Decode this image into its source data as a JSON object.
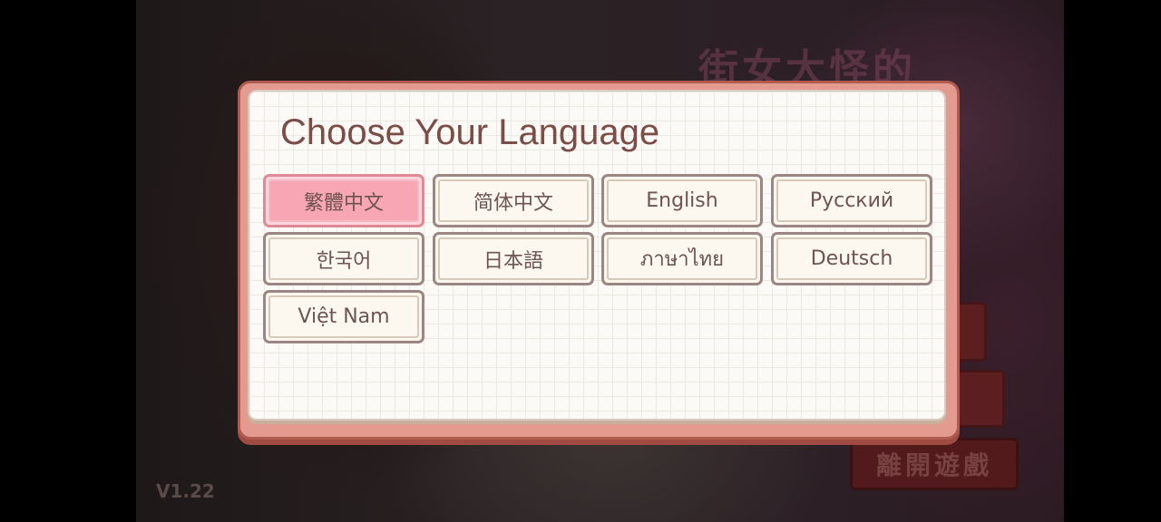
{
  "background": {
    "logo_text": "街女大怪的",
    "exit_button_label": "離開遊戲",
    "version": "V1.22"
  },
  "dialog": {
    "title": "Choose Your Language",
    "languages": [
      {
        "label": "繁體中文",
        "selected": true
      },
      {
        "label": "简体中文",
        "selected": false
      },
      {
        "label": "English",
        "selected": false
      },
      {
        "label": "Русский",
        "selected": false
      },
      {
        "label": "한국어",
        "selected": false
      },
      {
        "label": "日本語",
        "selected": false
      },
      {
        "label": "ภาษาไทย",
        "selected": false
      },
      {
        "label": "Deutsch",
        "selected": false
      },
      {
        "label": "Việt Nam",
        "selected": false
      }
    ]
  },
  "colors": {
    "selected_button": "#f8a5b4",
    "dialog_frame": "#e39a8f",
    "title_text": "#7a4d48"
  }
}
